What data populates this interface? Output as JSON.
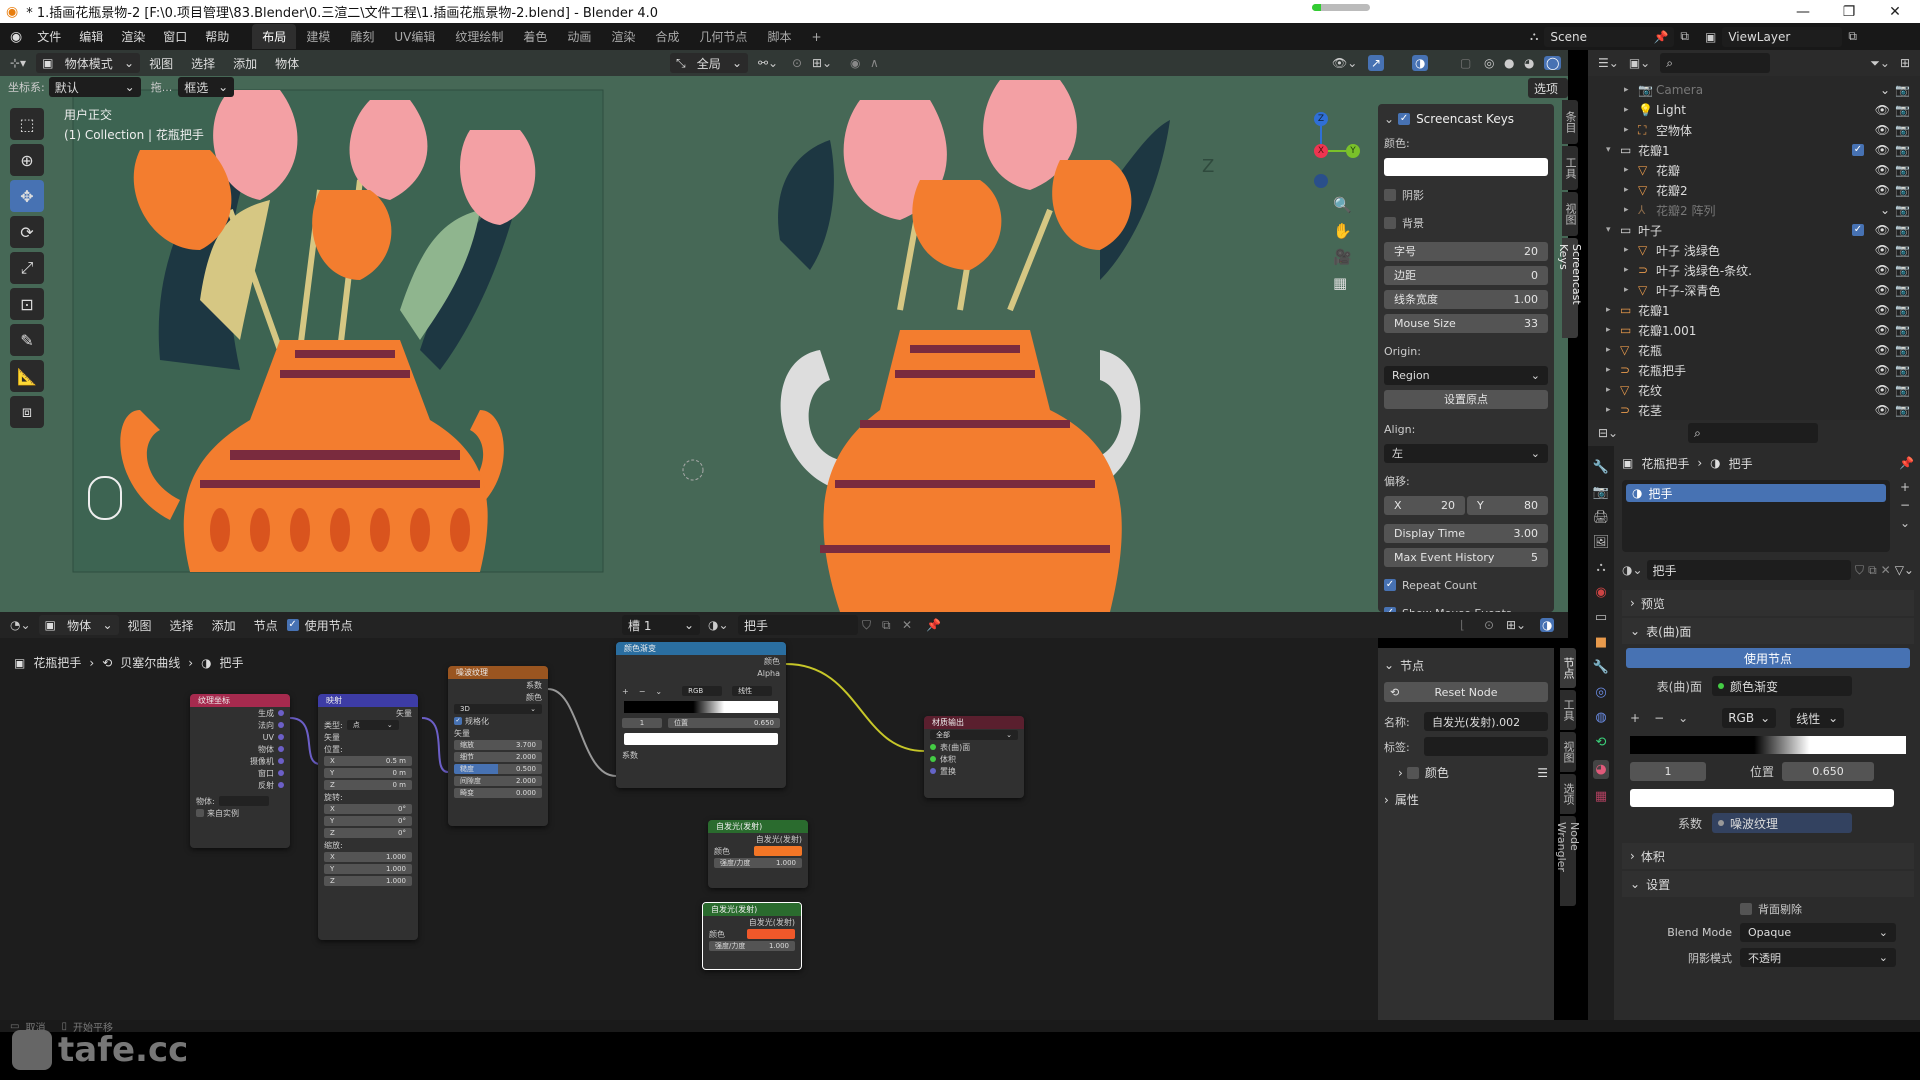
{
  "window": {
    "title": "* 1.插画花瓶景物-2 [F:\\0.项目管理\\83.Blender\\0.三渲二\\文件工程\\1.插画花瓶景物-2.blend] - Blender 4.0",
    "progress_fraction": 0.15
  },
  "topbar": {
    "menus": [
      "文件",
      "编辑",
      "渲染",
      "窗口",
      "帮助"
    ],
    "workspaces": [
      "布局",
      "建模",
      "雕刻",
      "UV编辑",
      "纹理绘制",
      "着色",
      "动画",
      "渲染",
      "合成",
      "几何节点",
      "脚本"
    ],
    "active_workspace": "布局",
    "add_tab": "+",
    "scene": "Scene",
    "view_layer": "ViewLayer"
  },
  "viewport": {
    "mode": "物体模式",
    "menus": [
      "视图",
      "选择",
      "添加",
      "物体"
    ],
    "transform_orientation": "全局",
    "coord_label": "坐标系:",
    "coord_value": "默认",
    "drag_label": "拖...",
    "select_mode": "框选",
    "options": "选项",
    "view_name": "用户正交",
    "collection_info": "(1) Collection | 花瓶把手",
    "tools": [
      "select-box",
      "cursor",
      "move",
      "rotate",
      "scale",
      "transform",
      "annotate",
      "measure",
      "add-cube"
    ],
    "active_tool": "move",
    "gizmo_axes": [
      "Z",
      "X",
      "Y"
    ]
  },
  "screencast_keys": {
    "header": "Screencast Keys",
    "enabled": true,
    "color_label": "颜色:",
    "color_value": "#ffffff",
    "shadow_label": "阴影",
    "shadow": false,
    "background_label": "背景",
    "background": false,
    "fields": [
      {
        "label": "字号",
        "value": "20"
      },
      {
        "label": "边距",
        "value": "0"
      },
      {
        "label": "线条宽度",
        "value": "1.00"
      },
      {
        "label": "Mouse Size",
        "value": "33"
      }
    ],
    "origin_label": "Origin:",
    "origin_value": "Region",
    "set_origin_button": "设置原点",
    "align_label": "Align:",
    "align_value": "左",
    "offset_label": "偏移:",
    "offset_x_label": "X",
    "offset_x": "20",
    "offset_y_label": "Y",
    "offset_y": "80",
    "display_time_label": "Display Time",
    "display_time": "3.00",
    "max_history_label": "Max Event History",
    "max_history": "5",
    "repeat_count_label": "Repeat Count",
    "repeat_count": true,
    "show_mouse_label": "Show Mouse Events",
    "show_mouse": true
  },
  "viewport_sidetabs": [
    "条目",
    "工具",
    "视图",
    "Screencast Keys"
  ],
  "outliner": {
    "items": [
      {
        "name": "Camera",
        "indent": 2,
        "type": "camera",
        "dim": true
      },
      {
        "name": "Light",
        "indent": 2,
        "type": "light"
      },
      {
        "name": "空物体",
        "indent": 2,
        "type": "empty"
      },
      {
        "name": "花瓣1",
        "indent": 1,
        "type": "collection",
        "expanded": true,
        "checked": true
      },
      {
        "name": "花瓣",
        "indent": 2,
        "type": "mesh"
      },
      {
        "name": "花瓣2",
        "indent": 2,
        "type": "mesh"
      },
      {
        "name": "花瓣2 阵列",
        "indent": 2,
        "type": "modifier",
        "dim": true
      },
      {
        "name": "叶子",
        "indent": 1,
        "type": "collection",
        "expanded": true,
        "checked": true
      },
      {
        "name": "叶子 浅绿色",
        "indent": 2,
        "type": "mesh"
      },
      {
        "name": "叶子 浅绿色-条纹.",
        "indent": 2,
        "type": "curve"
      },
      {
        "name": "叶子-深青色",
        "indent": 2,
        "type": "mesh"
      },
      {
        "name": "花瓣1",
        "indent": 1,
        "type": "collection-instance"
      },
      {
        "name": "花瓣1.001",
        "indent": 1,
        "type": "collection-instance"
      },
      {
        "name": "花瓶",
        "indent": 1,
        "type": "mesh"
      },
      {
        "name": "花瓶把手",
        "indent": 1,
        "type": "curve",
        "selected": true
      },
      {
        "name": "花纹",
        "indent": 1,
        "type": "mesh"
      },
      {
        "name": "花茎",
        "indent": 1,
        "type": "curve"
      }
    ]
  },
  "properties": {
    "breadcrumb_object": "花瓶把手",
    "breadcrumb_material": "把手",
    "slot_name": "把手",
    "material_name": "把手",
    "sections": {
      "preview": "预览",
      "surface": "表(曲)面",
      "volume": "体积",
      "settings": "设置"
    },
    "use_nodes_button": "使用节点",
    "surface_label": "表(曲)面",
    "surface_value": "颜色渐变",
    "color_mode": "RGB",
    "interp": "线性",
    "stop_index": "1",
    "position_label": "位置",
    "position_value": "0.650",
    "factor_label": "系数",
    "factor_value": "噪波纹理",
    "backface_label": "背面剔除",
    "blend_mode_label": "Blend Mode",
    "blend_mode": "Opaque",
    "shadow_mode_label": "阴影模式",
    "shadow_mode": "不透明"
  },
  "node_editor": {
    "type_menu": "物体",
    "menus": [
      "视图",
      "选择",
      "添加",
      "节点"
    ],
    "use_nodes_label": "使用节点",
    "use_nodes": true,
    "slot": "槽 1",
    "material": "把手",
    "breadcrumb": [
      "花瓶把手",
      "贝塞尔曲线",
      "把手"
    ],
    "nodes": {
      "texcoord": {
        "title": "纹理坐标",
        "outputs": [
          "生成",
          "法向",
          "UV",
          "物体",
          "摄像机",
          "窗口",
          "反射"
        ],
        "object_label": "物体:",
        "from_instancer": "来自实例"
      },
      "mapping": {
        "title": "映射",
        "output": "矢量",
        "type_label": "类型:",
        "type_value": "点",
        "vector_in": "矢量",
        "location_label": "位置:",
        "location": [
          [
            "X",
            "0.5 m"
          ],
          [
            "Y",
            "0 m"
          ],
          [
            "Z",
            "0 m"
          ]
        ],
        "rotation_label": "旋转:",
        "rotation": [
          [
            "X",
            "0°"
          ],
          [
            "Y",
            "0°"
          ],
          [
            "Z",
            "0°"
          ]
        ],
        "scale_label": "缩放:",
        "scale": [
          [
            "X",
            "1.000"
          ],
          [
            "Y",
            "1.000"
          ],
          [
            "Z",
            "1.000"
          ]
        ]
      },
      "noise": {
        "title": "噪波纹理",
        "outputs": [
          "系数",
          "颜色"
        ],
        "dim": "3D",
        "normalize": "规格化",
        "vector_in": "矢量",
        "fields": [
          [
            "缩放",
            "3.700"
          ],
          [
            "细节",
            "2.000"
          ],
          [
            "糙度",
            "0.500"
          ],
          [
            "间隙度",
            "2.000"
          ],
          [
            "畸变",
            "0.000"
          ]
        ]
      },
      "ramp": {
        "title": "颜色渐变",
        "outputs": [
          "颜色",
          "Alpha"
        ],
        "mode": "RGB",
        "interp": "线性",
        "stop": "1",
        "pos_label": "位置",
        "pos_value": "0.650",
        "input": "系数"
      },
      "output": {
        "title": "材质输出",
        "target": "全部",
        "inputs": [
          "表(曲)面",
          "体积",
          "置换"
        ]
      },
      "emission1": {
        "title": "自发光(发射)",
        "output": "自发光(发射)",
        "color_label": "颜色",
        "strength_label": "强度/力度",
        "strength": "1.000",
        "color": "#f37626"
      },
      "emission2": {
        "title": "自发光(发射)",
        "output": "自发光(发射)",
        "color_label": "颜色",
        "strength_label": "强度/力度",
        "strength": "1.000",
        "color": "#f0582a"
      }
    }
  },
  "node_sidebar": {
    "section": "节点",
    "reset_button": "Reset Node",
    "name_label": "名称:",
    "name_value": "自发光(发射).002",
    "label_label": "标签:",
    "label_value": "",
    "color_label": "颜色",
    "properties_section": "属性",
    "tabs": [
      "节点",
      "工具",
      "视图",
      "选项",
      "Node Wrangler"
    ]
  },
  "statusbar": {
    "items": [
      "取消",
      "开始平移"
    ]
  },
  "watermark": "tafe.cc",
  "colors": {
    "accent": "#4772b3",
    "viewport_bg": "#466856",
    "vase_orange": "#f37d2f",
    "stripe": "#7a2b3e",
    "petal_pink": "#f3a0a4"
  }
}
